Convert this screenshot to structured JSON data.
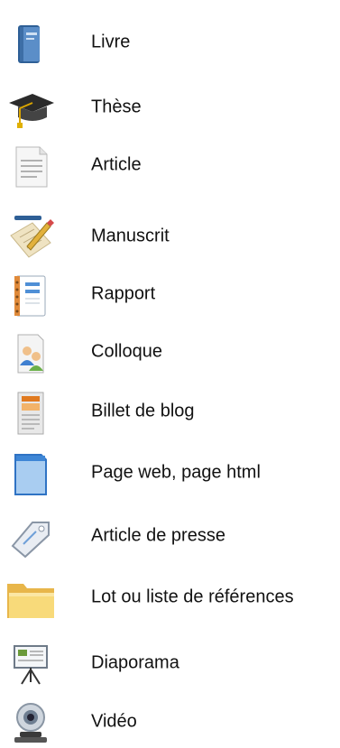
{
  "items": [
    {
      "label": "Livre",
      "icon": "book-icon"
    },
    {
      "label": "Thèse",
      "icon": "graduation-cap-icon"
    },
    {
      "label": "Article",
      "icon": "document-icon"
    },
    {
      "label": "Manuscrit",
      "icon": "pencil-manuscript-icon"
    },
    {
      "label": "Rapport",
      "icon": "notebook-icon"
    },
    {
      "label": "Colloque",
      "icon": "people-document-icon"
    },
    {
      "label": "Billet de blog",
      "icon": "blog-page-icon"
    },
    {
      "label": "Page web, page html",
      "icon": "web-page-icon"
    },
    {
      "label": "Article de presse",
      "icon": "press-tag-icon"
    },
    {
      "label": "Lot ou liste de références",
      "icon": "folder-icon"
    },
    {
      "label": "Diaporama",
      "icon": "presentation-board-icon"
    },
    {
      "label": "Vidéo",
      "icon": "webcam-icon"
    }
  ]
}
